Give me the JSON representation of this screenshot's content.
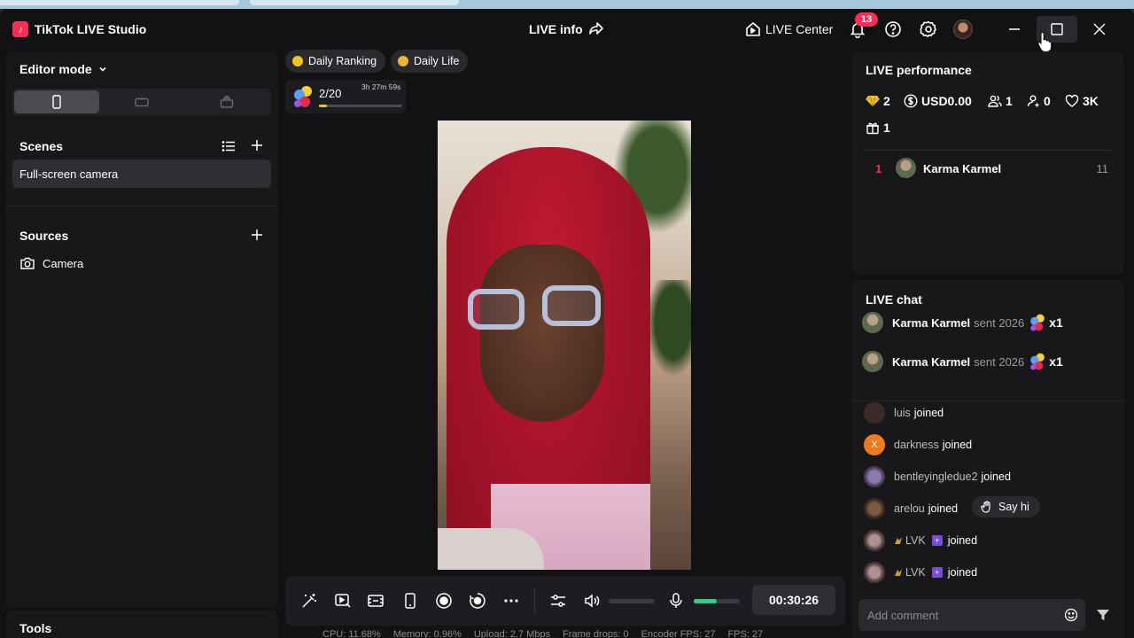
{
  "titlebar": {
    "app_title": "TikTok LIVE Studio",
    "live_info": "LIVE info",
    "live_center": "LIVE Center",
    "notification_count": "13"
  },
  "left": {
    "editor_mode": "Editor mode",
    "scenes_label": "Scenes",
    "scene_items": [
      "Full-screen camera"
    ],
    "sources_label": "Sources",
    "source_items": [
      "Camera"
    ],
    "tools_label": "Tools"
  },
  "center": {
    "tags": [
      "Daily Ranking",
      "Daily Life"
    ],
    "ranking": {
      "count": "2/20",
      "timer": "3h 27m 59s",
      "progress": 0.1
    },
    "timer": "00:30:26",
    "mic_level": 0.5,
    "status": [
      "CPU: 11.68%",
      "Memory: 0.96%",
      "Upload: 2.7 Mbps",
      "Frame drops: 0",
      "Encoder FPS: 27",
      "FPS: 27"
    ]
  },
  "performance": {
    "title": "LIVE performance",
    "diamonds": "2",
    "earnings": "USD0.00",
    "viewers": "1",
    "new_followers": "0",
    "likes": "3K",
    "gifters": "1",
    "top_viewers": [
      {
        "rank": "1",
        "name": "Karma Karmel",
        "score": "11"
      }
    ]
  },
  "chat": {
    "title": "LIVE chat",
    "gifts": [
      {
        "name": "Karma Karmel",
        "action": "sent 2026",
        "qty": "x1"
      },
      {
        "name": "Karma Karmel",
        "action": "sent 2026",
        "qty": "x1"
      }
    ],
    "joins": [
      {
        "name": "luis",
        "action": "joined"
      },
      {
        "name": "darkness",
        "action": "joined",
        "initial": "X"
      },
      {
        "name": "bentleyingledue2",
        "action": "joined"
      },
      {
        "name": "arelou",
        "action": "joined"
      },
      {
        "name": "LVK",
        "action": "joined"
      },
      {
        "name": "LVK",
        "action": "joined"
      }
    ],
    "say_hi": "Say hi",
    "comment_placeholder": "Add comment"
  },
  "colors": {
    "accent": "#fe2c55",
    "mic_level": "#2fd08c",
    "ranking_progress": "#f2c12e"
  }
}
